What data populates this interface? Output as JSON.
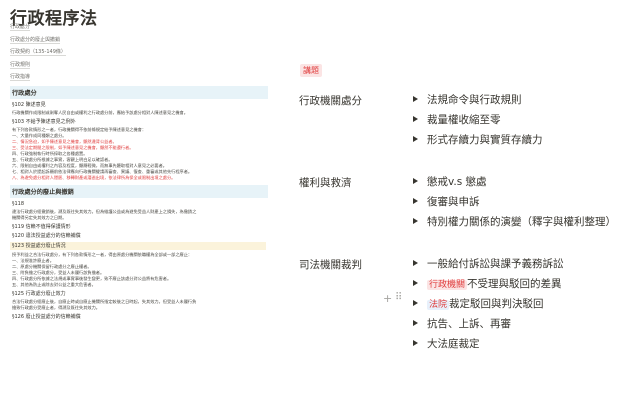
{
  "page": {
    "title": "行政程序法"
  },
  "toc": [
    "行政處分",
    "行政處分的廢止與撤銷",
    "行政契約（135-149條）",
    "行政規則",
    "行政指導"
  ],
  "left": {
    "section1": {
      "heading": "行政處分",
      "s102": "§102 陳述意見",
      "s102_text": "行政機關作成限制或剝奪人民自由或權利之行政處分前，應給予該處分相對人陳述意見之機會。",
      "s103": "§103 不給予陳述意見之例外",
      "s103_intro": "有下列各款情形之一者，行政機關得不依前條規定給予陳述意見之機會：",
      "s103_items": [
        "一、大量作成同種類之處分。",
        "二、情況急迫，如予陳述意見之機會，顯然違背公益者。",
        "三、受法定期間之限制，如予陳述意見之機會，顯然不能遵行者。",
        "四、行政強制執行時所採取之各種處置。",
        "五、行政處分所根據之事實，客觀上明白足以確認者。",
        "六、限制自由或權利之內容及程度，顯屬輕微，而無事先聽取相對人意見之必要者。",
        "七、相對人於提起訴願前依法律應向行政機關聲請再審查、異議、復查、重審或其他先行程序者。",
        "八、為避免處分相對人隱匿、移轉財產或潛逃出境，依法律所為保全或限制出境之處分。"
      ]
    },
    "section2": {
      "heading": "行政處分的廢止與撤銷",
      "s118": "§118",
      "s118_text_1": "違法行政處分經撤銷後，溯及既往失其效力。但為維護公益或為避免受益人財產上之損失，為撤銷之",
      "s118_text_2": "機關得另定失其效力之日期。",
      "s119": "§119 信賴不值得保護情形",
      "s120": "§120 違法授益處分的信賴補償",
      "s123": "§123 授益處分廢止情況",
      "s123_intro": "授予利益之合法行政處分，有下列各款情形之一者，得由原處分機關依職權為全部或一部之廢止：",
      "s123_items": [
        "一、法規准許廢止者。",
        "二、原處分機關保留行政處分之廢止權者。",
        "三、附負擔之行政處分，受益人未履行該負擔者。",
        "四、行政處分所依據之法規或事實事後發生變更，致不廢止該處分對公益將有危害者。",
        "五、其他為防止或除去對公益之重大危害者。"
      ],
      "s125": "§125 行政處分廢止效力",
      "s125_text_1": "合法行政處分經廢止後，自廢止時或自廢止機關所指定較後之日時起，失其效力。但受益人未履行負",
      "s125_text_2": "擔致行政處分受廢止者，得溯及既往失其效力。",
      "s126": "§126 廢止授益處分的信賴補償"
    }
  },
  "right": {
    "tag": "講題",
    "groups": [
      {
        "category": "行政機關處分",
        "items": [
          "法規命令與行政規則",
          "裁量權收縮至零",
          "形式存續力與實質存續力"
        ]
      },
      {
        "category": "權利與救濟",
        "items": [
          "懲戒v.s 懲處",
          "復審與申訴",
          "特別權力關係的演變（釋字與權利整理）"
        ]
      },
      {
        "category": "司法機關裁判",
        "items": [
          "一般給付訴訟與課予義務訴訟",
          "不受理與駁回的差異",
          "裁定駁回與判決駁回",
          "抗告、上訴、再審",
          "大法庭裁定"
        ],
        "pill_agency": "行政機關",
        "pill_court": "法院"
      }
    ]
  },
  "icons": {
    "add": "plus-icon",
    "drag": "drag-handle-icon"
  },
  "colors": {
    "callout_blue": "#e7f3f8",
    "highlight_yellow": "#fbf3db",
    "tag_red": "#e03e3e",
    "tag_bg": "#fbe4e4"
  }
}
